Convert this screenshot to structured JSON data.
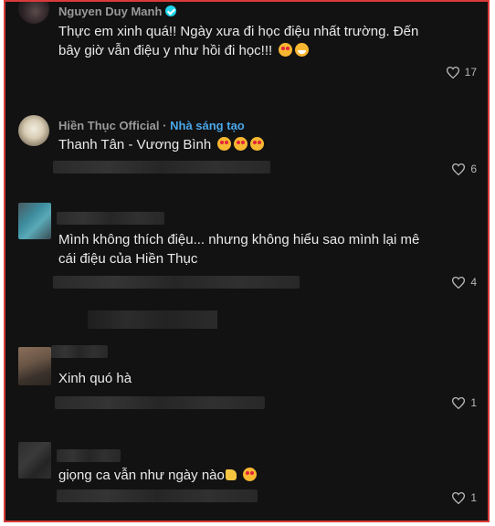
{
  "comments": [
    {
      "author": "Nguyen Duy Manh",
      "verified": true,
      "text_line1": "Thực em xinh quá!! Ngày xưa đi học điệu nhất trường. Đến",
      "text_line2": "bây giờ vẫn điệu y như hồi đi học!!!",
      "likes": "17",
      "emojis": [
        "smiling-face-with-heart-eyes",
        "grinning-face"
      ]
    },
    {
      "author": "Hiền Thục Official",
      "separator": "·",
      "creator_label": "Nhà sáng tạo",
      "text": "Thanh Tân - Vương Bình",
      "likes": "6",
      "emojis": [
        "smiling-face-with-heart-eyes",
        "smiling-face-with-heart-eyes",
        "smiling-face-with-heart-eyes"
      ]
    },
    {
      "author_hidden": true,
      "text_line1": "Mình không thích điệu... nhưng không hiểu sao mình lại mê",
      "text_line2": "cái điệu của Hiền Thục",
      "likes": "4"
    },
    {
      "author_hidden": true,
      "text": "Xinh quó hà",
      "likes": "1"
    },
    {
      "author_hidden": true,
      "text": "giọng ca vẫn như ngày nào",
      "likes": "1",
      "emojis": [
        "thumbs-up",
        "smiling-face-with-heart-eyes"
      ]
    }
  ],
  "colors": {
    "background": "#121212",
    "frame_border": "#d93a3a",
    "text": "#eaeaea",
    "author": "#9a9a9a",
    "creator_badge": "#4aa6e8",
    "verified_badge": "#20d5ec"
  }
}
